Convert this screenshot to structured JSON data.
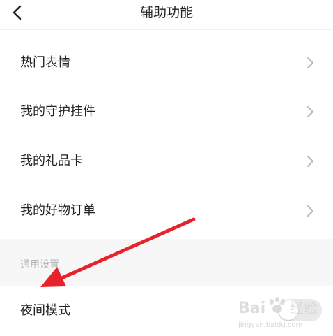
{
  "header": {
    "title": "辅助功能"
  },
  "rows": [
    {
      "label": "热门表情"
    },
    {
      "label": "我的守护挂件"
    },
    {
      "label": "我的礼品卡"
    },
    {
      "label": "我的好物订单"
    }
  ],
  "section": {
    "label": "通用设置"
  },
  "night_mode": {
    "label": "夜间模式",
    "enabled": false
  },
  "watermark": {
    "brand": "Bai度经验",
    "url": "jingyan.baidu.com"
  },
  "colors": {
    "annotation_arrow": "#e8222a",
    "toggle_off": "#e9e9e9",
    "section_bg": "#f7f7f7",
    "section_text": "#b5b5b5",
    "chevron": "#b8b8b8"
  },
  "icons": {
    "back": "chevron-left-icon",
    "row_arrow": "chevron-right-icon"
  }
}
